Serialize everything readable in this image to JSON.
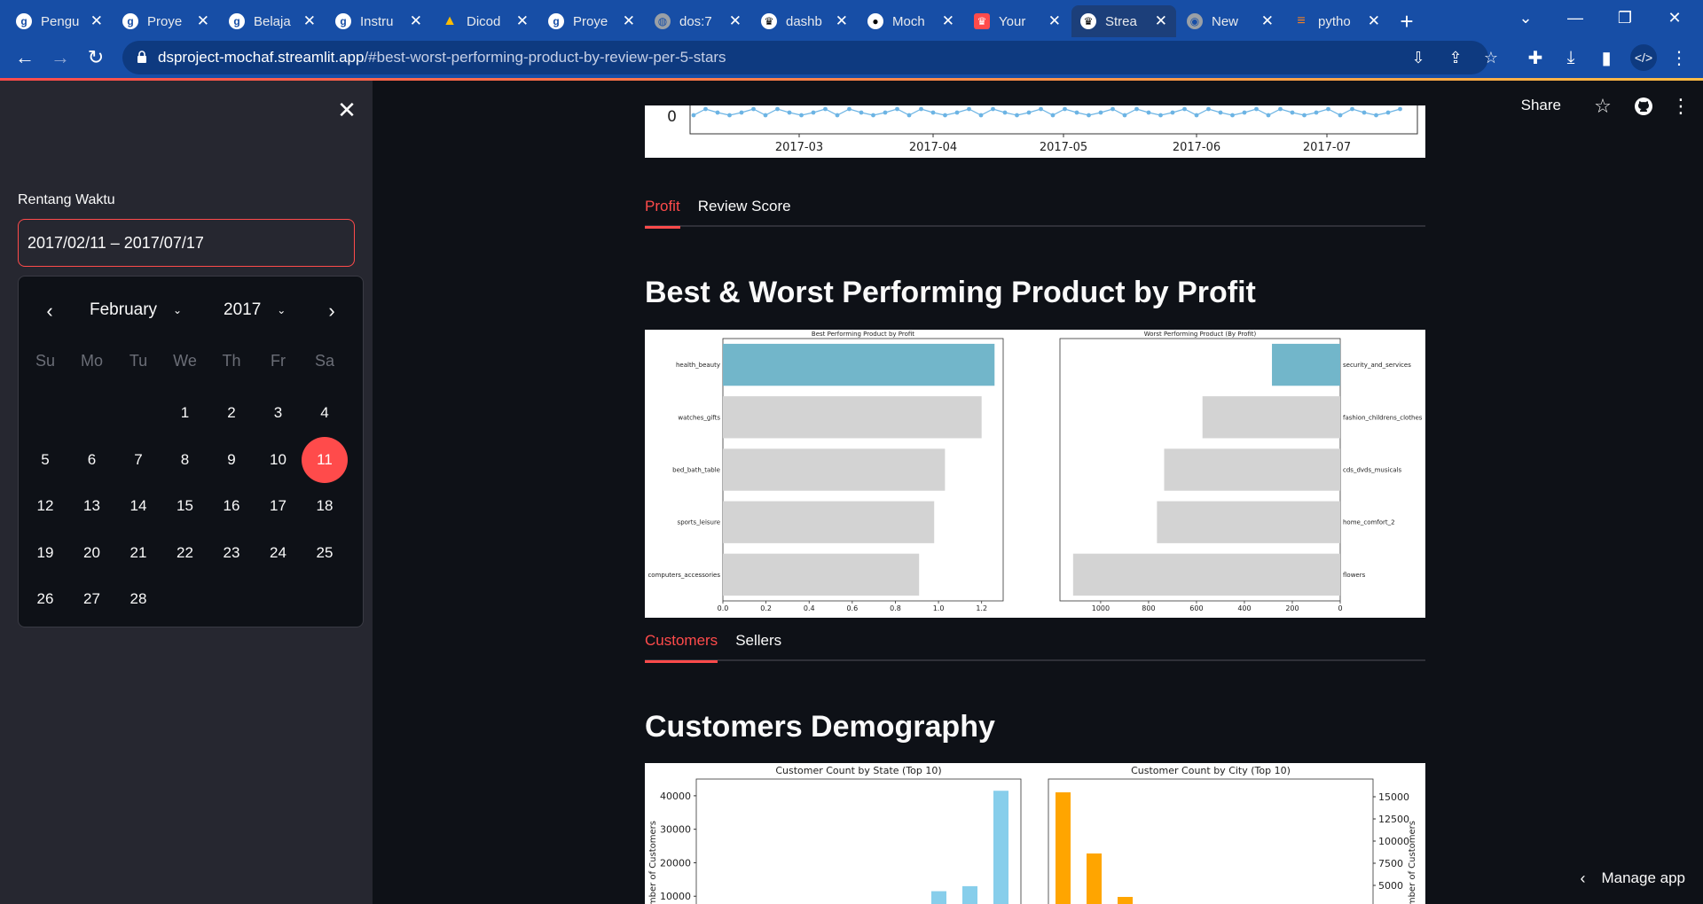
{
  "browser": {
    "tabs": [
      {
        "title": "Pengu",
        "icon": "g-icon",
        "glyph": "g"
      },
      {
        "title": "Proye",
        "icon": "g-icon",
        "glyph": "g"
      },
      {
        "title": "Belaja",
        "icon": "g-icon",
        "glyph": "g"
      },
      {
        "title": "Instru",
        "icon": "g-icon",
        "glyph": "g"
      },
      {
        "title": "Dicod",
        "icon": "drive-icon",
        "glyph": "▲"
      },
      {
        "title": "Proye",
        "icon": "g-icon",
        "glyph": "g"
      },
      {
        "title": "dos:7",
        "icon": "globe-icon",
        "glyph": "◍"
      },
      {
        "title": "dashb",
        "icon": "streamlit-icon",
        "glyph": "♛"
      },
      {
        "title": "Moch",
        "icon": "github-icon",
        "glyph": "●"
      },
      {
        "title": "Your",
        "icon": "streamlit-red-icon",
        "glyph": "♛"
      },
      {
        "title": "Strea",
        "icon": "streamlit-icon",
        "glyph": "♛",
        "active": true
      },
      {
        "title": "New",
        "icon": "chrome-icon",
        "glyph": "◉"
      },
      {
        "title": "pytho",
        "icon": "stackoverflow-icon",
        "glyph": "≡"
      }
    ],
    "url_host": "dsproject-mochaf.streamlit.app",
    "url_path": "/#best-worst-performing-product-by-review-per-5-stars"
  },
  "sidebar": {
    "date_label": "Rentang Waktu",
    "date_value": "2017/02/11 – 2017/07/17",
    "calendar": {
      "month": "February",
      "year": "2017",
      "weekdays": [
        "Su",
        "Mo",
        "Tu",
        "We",
        "Th",
        "Fr",
        "Sa"
      ],
      "first_weekday": 3,
      "days_in_month": 28,
      "selected_day": 11
    }
  },
  "header": {
    "share_label": "Share"
  },
  "timeseries_fragment": {
    "y_tick": "0",
    "x_ticks": [
      "2017-03",
      "2017-04",
      "2017-05",
      "2017-06",
      "2017-07"
    ]
  },
  "profit_section": {
    "tabs": [
      {
        "label": "Profit",
        "active": true
      },
      {
        "label": "Review Score",
        "active": false
      }
    ],
    "heading": "Best & Worst Performing Product by Profit"
  },
  "customers_section": {
    "tabs": [
      {
        "label": "Customers",
        "active": true
      },
      {
        "label": "Sellers",
        "active": false
      }
    ],
    "heading": "Customers Demography"
  },
  "manage_app_label": "Manage app",
  "chart_data": [
    {
      "type": "bar",
      "orientation": "horizontal",
      "title": "Best Performing Product by Profit",
      "categories": [
        "health_beauty",
        "watches_gifts",
        "bed_bath_table",
        "sports_leisure",
        "computers_accessories"
      ],
      "values": [
        1.26,
        1.2,
        1.03,
        0.98,
        0.91
      ],
      "xlim": [
        0,
        1.3
      ],
      "x_ticks": [
        "0.0",
        "0.2",
        "0.4",
        "0.6",
        "0.8",
        "1.0",
        "1.2"
      ],
      "highlight_color": "#72B6CA",
      "base_color": "#D3D3D3"
    },
    {
      "type": "bar",
      "orientation": "horizontal",
      "title": "Worst Performing Product (By Profit)",
      "categories": [
        "security_and_services",
        "fashion_childrens_clothes",
        "cds_dvds_musicals",
        "home_comfort_2",
        "flowers"
      ],
      "values": [
        285,
        575,
        735,
        765,
        1115
      ],
      "xlim": [
        1170,
        0
      ],
      "x_ticks": [
        "1000",
        "800",
        "600",
        "400",
        "200",
        "0"
      ],
      "highlight_color": "#72B6CA",
      "base_color": "#D3D3D3"
    },
    {
      "type": "bar",
      "title": "Customer Count by State (Top 10)",
      "ylabel": "Number of Customers",
      "y_ticks": [
        "10000",
        "20000",
        "30000",
        "40000"
      ],
      "values_visible": [
        11500,
        13000,
        41500
      ],
      "color": "#87CEEB"
    },
    {
      "type": "bar",
      "title": "Customer Count by City (Top 10)",
      "ylabel": "Number of Customers",
      "y_ticks": [
        "2500",
        "5000",
        "7500",
        "10000",
        "12500",
        "15000"
      ],
      "values_visible": [
        15500,
        8600,
        3700
      ],
      "color": "#FFA500"
    }
  ]
}
